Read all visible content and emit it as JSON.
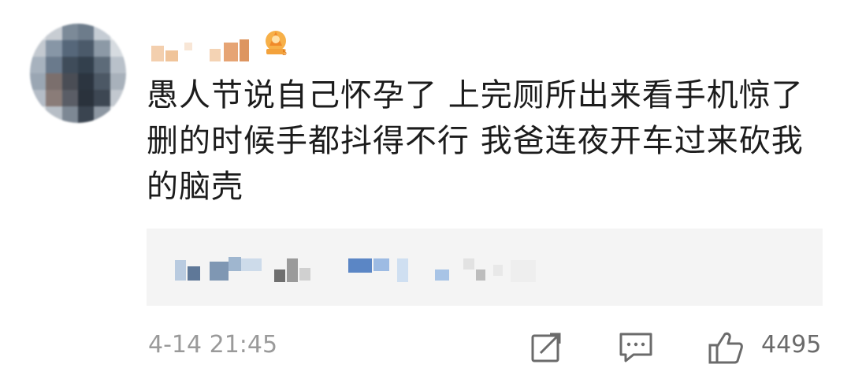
{
  "post": {
    "content": "愚人节说自己怀孕了 上完厕所出来看手机惊了 删的时候手都抖得不行 我爸连夜开车过来砍我的脑壳",
    "timestamp": "4-14 21:45",
    "like_count": "4495"
  },
  "icons": {
    "share": "share-icon",
    "comment": "comment-icon",
    "like": "like-icon",
    "badge": "membership-badge-icon"
  }
}
